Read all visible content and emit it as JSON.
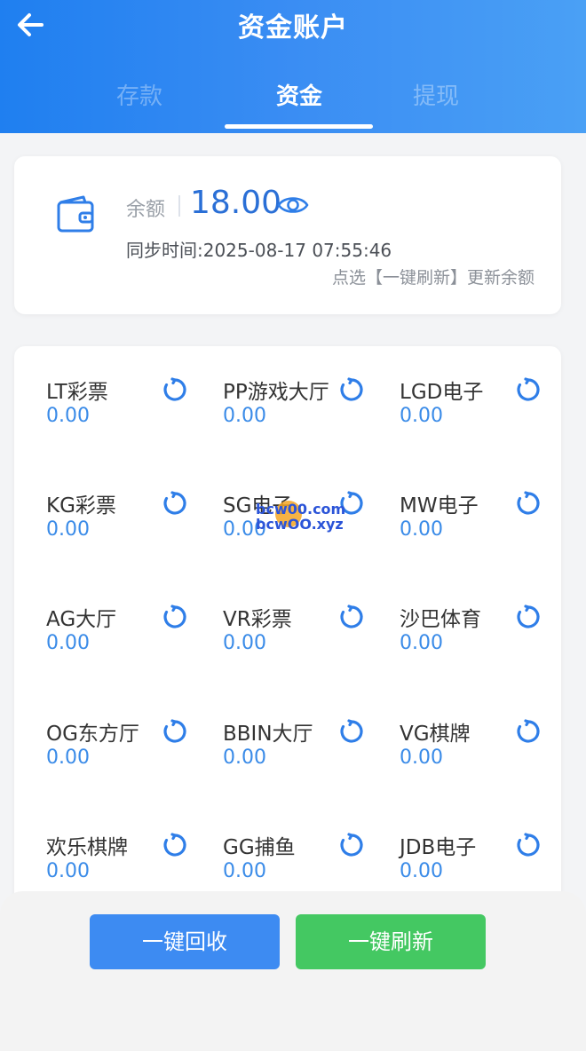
{
  "header": {
    "title": "资金账户",
    "tabs": [
      {
        "label": "存款",
        "active": false
      },
      {
        "label": "资金",
        "active": true
      },
      {
        "label": "提现",
        "active": false
      }
    ]
  },
  "balance": {
    "label": "余额",
    "value": "18.00",
    "sync_time": "同步时间:2025-08-17 07:55:46",
    "hint": "点选【一键刷新】更新余额"
  },
  "games": [
    {
      "name": "LT彩票",
      "value": "0.00"
    },
    {
      "name": "PP游戏大厅",
      "value": "0.00"
    },
    {
      "name": "LGD电子",
      "value": "0.00"
    },
    {
      "name": "KG彩票",
      "value": "0.00"
    },
    {
      "name": "SG电子",
      "value": "0.00"
    },
    {
      "name": "MW电子",
      "value": "0.00"
    },
    {
      "name": "AG大厅",
      "value": "0.00"
    },
    {
      "name": "VR彩票",
      "value": "0.00"
    },
    {
      "name": "沙巴体育",
      "value": "0.00"
    },
    {
      "name": "OG东方厅",
      "value": "0.00"
    },
    {
      "name": "BBIN大厅",
      "value": "0.00"
    },
    {
      "name": "VG棋牌",
      "value": "0.00"
    },
    {
      "name": "欢乐棋牌",
      "value": "0.00"
    },
    {
      "name": "GG捕鱼",
      "value": "0.00"
    },
    {
      "name": "JDB电子",
      "value": "0.00"
    }
  ],
  "watermark": {
    "line1": "bcw00.com",
    "line2": "bcwOO.xyz"
  },
  "footer": {
    "recover_label": "一键回收",
    "refresh_label": "一键刷新"
  },
  "colors": {
    "accent": "#1f7ff0",
    "value_blue": "#3a8be8",
    "green": "#44c862"
  }
}
